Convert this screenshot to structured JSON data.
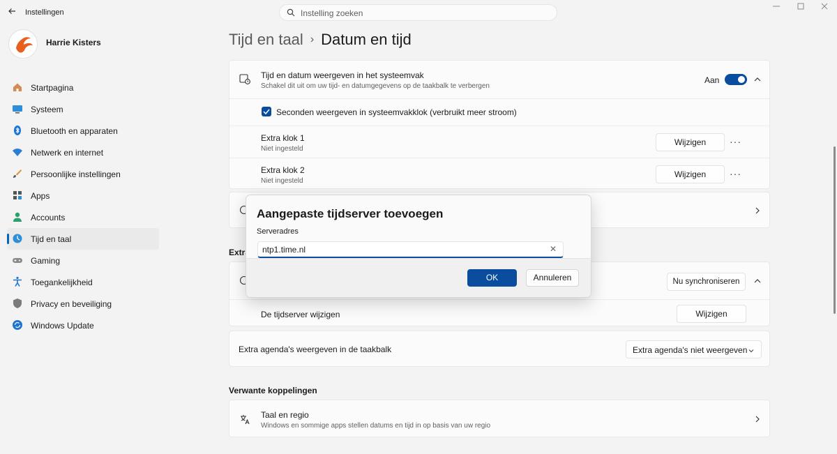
{
  "window": {
    "title": "Instellingen",
    "back_icon": "arrow-left-icon",
    "controls": [
      "minimize-icon",
      "maximize-icon",
      "close-icon"
    ]
  },
  "search": {
    "placeholder": "Instelling zoeken",
    "value": ""
  },
  "profile": {
    "name": "Harrie Kisters"
  },
  "sidebar": {
    "items": [
      {
        "label": "Startpagina",
        "icon": "home-icon"
      },
      {
        "label": "Systeem",
        "icon": "system-icon"
      },
      {
        "label": "Bluetooth en apparaten",
        "icon": "bluetooth-icon"
      },
      {
        "label": "Netwerk en internet",
        "icon": "wifi-icon"
      },
      {
        "label": "Persoonlijke instellingen",
        "icon": "brush-icon"
      },
      {
        "label": "Apps",
        "icon": "apps-icon"
      },
      {
        "label": "Accounts",
        "icon": "account-icon"
      },
      {
        "label": "Tijd en taal",
        "icon": "time-language-icon",
        "active": true
      },
      {
        "label": "Gaming",
        "icon": "gamepad-icon"
      },
      {
        "label": "Toegankelijkheid",
        "icon": "accessibility-icon"
      },
      {
        "label": "Privacy en beveiliging",
        "icon": "shield-icon"
      },
      {
        "label": "Windows Update",
        "icon": "update-icon"
      }
    ]
  },
  "breadcrumb": {
    "parent": "Tijd en taal",
    "separator": "›",
    "current": "Datum en tijd"
  },
  "systray_card": {
    "title": "Tijd en datum weergeven in het systeemvak",
    "subtitle": "Schakel dit uit om uw tijd- en datumgegevens op de taakbalk te verbergen",
    "toggle_label": "Aan",
    "toggle_on": true,
    "seconds_checkbox_label": "Seconden weergeven in systeemvakklok (verbruikt meer stroom)",
    "seconds_checked": true,
    "clocks": [
      {
        "title": "Extra klok 1",
        "subtitle": "Niet ingesteld",
        "button": "Wijzigen"
      },
      {
        "title": "Extra klok 2",
        "subtitle": "Niet ingesteld",
        "button": "Wijzigen"
      }
    ]
  },
  "extra_section": {
    "partial_title": "Extra",
    "sync_button": "Nu synchroniseren",
    "timeserver_label": "De tijdserver wijzigen",
    "timeserver_button": "Wijzigen"
  },
  "calendar_row": {
    "label": "Extra agenda's weergeven in de taakbalk",
    "dropdown_value": "Extra agenda's niet weergeven"
  },
  "related": {
    "title": "Verwante koppelingen",
    "link_title": "Taal en regio",
    "link_subtitle": "Windows en sommige apps stellen datums en tijd in op basis van uw regio"
  },
  "dialog": {
    "title": "Aangepaste tijdserver toevoegen",
    "field_label": "Serveradres",
    "field_value": "ntp1.time.nl",
    "ok_button": "OK",
    "cancel_button": "Annuleren"
  },
  "colors": {
    "accent": "#0a4c9e",
    "background": "#f3f3f3",
    "card": "#fbfbfb"
  }
}
